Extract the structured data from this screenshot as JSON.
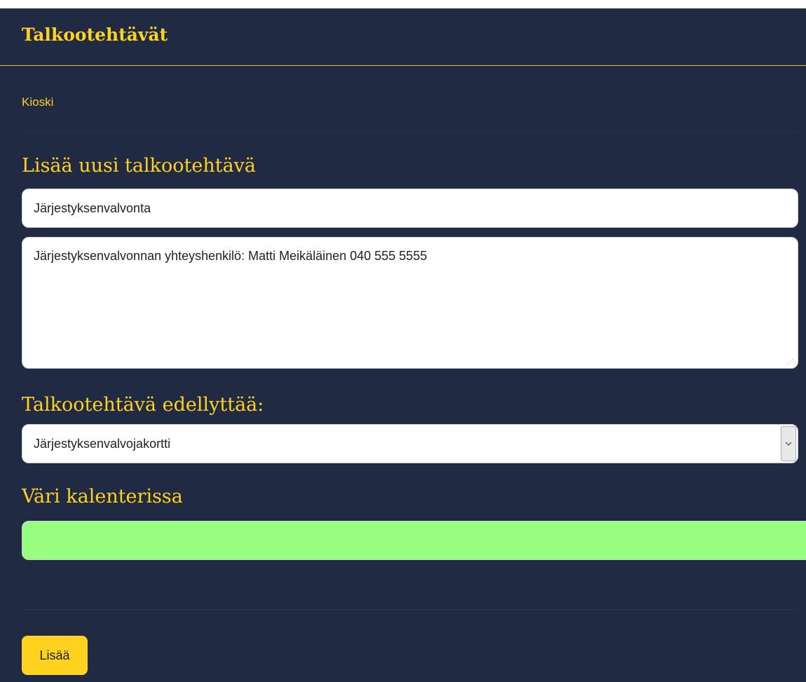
{
  "header": {
    "title": "Talkootehtävät"
  },
  "nav": {
    "link_label": "Kioski"
  },
  "form": {
    "section_title": "Lisää uusi talkootehtävä",
    "name_value": "Järjestyksenvalvonta",
    "description_value": "Järjestyksenvalvonnan yhteyshenkilö: Matti Meikäläinen 040 555 5555",
    "requirement_title": "Talkootehtävä edellyttää:",
    "requirement_selected": "Järjestyksenvalvojakortti",
    "color_title": "Väri kalenterissa",
    "color_value": "#99ff80",
    "submit_label": "Lisää"
  },
  "icons": {
    "select_arrow": "chevron-down-icon",
    "resize": "resize-grip-icon"
  },
  "colors": {
    "background": "#212a43",
    "accent": "#ffd21f",
    "header_rule": "#f5c518",
    "field_background": "#ffffff"
  }
}
